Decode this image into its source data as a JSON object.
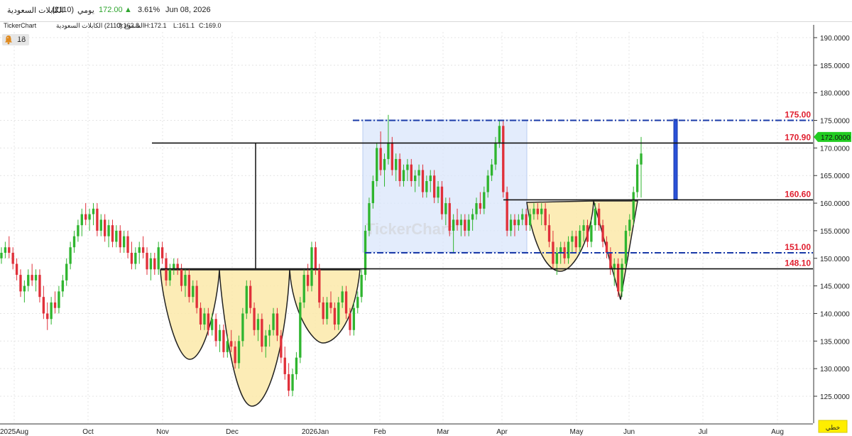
{
  "header": {
    "symbol_name": "الكابلات السعودية",
    "symbol_code": "(2110)",
    "interval": "يومي",
    "last_price": "172.00",
    "change_arrow": "▲",
    "change_pct": "3.61%",
    "date": "Jun 08, 2026"
  },
  "subheader": {
    "brand": "TickerChart",
    "series_label": "الشموع (2110) الكابلات السعودية",
    "open": "O:162.8",
    "high": "H:172.1",
    "low": "L:161.1",
    "close": "C:169.0"
  },
  "alerts": {
    "count": "18"
  },
  "watermark": "TickerChart",
  "colors": {
    "up": "#2fb52f",
    "down": "#e0303a",
    "shade_pattern": "#fbe9a9",
    "shade_box": "#d9e6fb",
    "level_label": "#e02030",
    "blue_line": "#1a3aa8"
  },
  "chart_data": {
    "type": "candlestick",
    "x_tick_labels": [
      "2025Aug",
      "Oct",
      "Nov",
      "Dec",
      "2026Jan",
      "Feb",
      "Mar",
      "Apr",
      "May",
      "Jun",
      "Jul",
      "Aug"
    ],
    "y_tick_labels": [
      "125.0000",
      "130.0000",
      "135.0000",
      "140.0000",
      "145.0000",
      "150.0000",
      "155.0000",
      "160.0000",
      "165.0000",
      "170.0000",
      "175.0000",
      "180.0000",
      "185.0000",
      "190.0000"
    ],
    "ylim": [
      122,
      192
    ],
    "current_price_label": "172.0000",
    "corner_label": "خطي",
    "levels": [
      {
        "label": "175.00",
        "value": 175.0,
        "style": "dash-dot",
        "color": "blue"
      },
      {
        "label": "170.90",
        "value": 170.9,
        "style": "solid",
        "color": "black"
      },
      {
        "label": "160.60",
        "value": 160.6,
        "style": "solid",
        "color": "black"
      },
      {
        "label": "151.00",
        "value": 151.0,
        "style": "dash-dot",
        "color": "blue"
      },
      {
        "label": "148.10",
        "value": 148.1,
        "style": "solid",
        "color": "black"
      }
    ],
    "series": [
      {
        "values": [
          [
            150,
            152,
            149,
            151
          ],
          [
            151,
            153,
            150,
            152
          ],
          [
            152,
            154,
            150,
            151
          ],
          [
            151,
            152,
            148,
            149
          ],
          [
            149,
            150,
            146,
            147
          ],
          [
            147,
            148,
            143,
            144
          ],
          [
            144,
            146,
            142,
            145
          ],
          [
            145,
            148,
            144,
            147
          ],
          [
            147,
            149,
            145,
            146
          ],
          [
            146,
            148,
            144,
            147
          ],
          [
            147,
            148,
            142,
            143
          ],
          [
            143,
            145,
            139,
            140
          ],
          [
            140,
            142,
            137,
            139
          ],
          [
            139,
            143,
            138,
            142
          ],
          [
            142,
            144,
            140,
            141
          ],
          [
            141,
            145,
            140,
            144
          ],
          [
            144,
            147,
            143,
            146
          ],
          [
            146,
            150,
            145,
            149
          ],
          [
            149,
            153,
            148,
            152
          ],
          [
            152,
            155,
            151,
            154
          ],
          [
            154,
            157,
            153,
            156
          ],
          [
            156,
            159,
            154,
            158
          ],
          [
            158,
            160,
            156,
            157
          ],
          [
            157,
            159,
            155,
            158
          ],
          [
            158,
            160,
            156,
            159
          ],
          [
            159,
            160,
            154,
            155
          ],
          [
            155,
            158,
            154,
            157
          ],
          [
            157,
            158,
            153,
            154
          ],
          [
            154,
            157,
            152,
            156
          ],
          [
            156,
            157,
            152,
            153
          ],
          [
            153,
            156,
            152,
            155
          ],
          [
            155,
            156,
            151,
            152
          ],
          [
            152,
            155,
            151,
            154
          ],
          [
            154,
            155,
            150,
            151
          ],
          [
            151,
            153,
            148,
            149
          ],
          [
            149,
            152,
            148,
            151
          ],
          [
            151,
            153,
            149,
            152
          ],
          [
            152,
            154,
            150,
            151
          ],
          [
            151,
            152,
            147,
            148
          ],
          [
            148,
            151,
            146,
            150
          ],
          [
            150,
            151,
            147,
            148
          ],
          [
            148,
            153,
            147,
            152
          ],
          [
            152,
            153,
            149,
            150
          ],
          [
            150,
            151,
            145,
            146
          ],
          [
            146,
            149,
            145,
            148
          ],
          [
            148,
            150,
            147,
            149
          ],
          [
            149,
            150,
            147,
            148
          ],
          [
            148,
            149,
            144,
            145
          ],
          [
            145,
            148,
            143,
            147
          ],
          [
            147,
            148,
            142,
            143
          ],
          [
            143,
            146,
            142,
            145
          ],
          [
            145,
            146,
            140,
            141
          ],
          [
            141,
            142,
            137,
            138
          ],
          [
            138,
            141,
            137,
            140
          ],
          [
            140,
            141,
            136,
            137
          ],
          [
            137,
            140,
            136,
            139
          ],
          [
            139,
            140,
            134,
            135
          ],
          [
            135,
            138,
            133,
            137
          ],
          [
            137,
            138,
            132,
            133
          ],
          [
            133,
            136,
            132,
            135
          ],
          [
            135,
            137,
            133,
            134
          ],
          [
            134,
            135,
            130,
            131
          ],
          [
            131,
            136,
            130,
            135
          ],
          [
            135,
            141,
            134,
            140
          ],
          [
            140,
            146,
            139,
            145
          ],
          [
            145,
            146,
            140,
            141
          ],
          [
            141,
            142,
            136,
            137
          ],
          [
            137,
            140,
            135,
            139
          ],
          [
            139,
            140,
            133,
            134
          ],
          [
            134,
            137,
            132,
            136
          ],
          [
            136,
            138,
            134,
            137
          ],
          [
            137,
            141,
            136,
            140
          ],
          [
            140,
            141,
            135,
            136
          ],
          [
            136,
            137,
            131,
            132
          ],
          [
            132,
            134,
            128,
            129
          ],
          [
            129,
            131,
            125,
            126
          ],
          [
            126,
            130,
            125,
            129
          ],
          [
            129,
            133,
            128,
            132
          ],
          [
            132,
            143,
            131,
            142
          ],
          [
            142,
            148,
            141,
            147
          ],
          [
            147,
            149,
            144,
            145
          ],
          [
            145,
            153,
            144,
            152
          ],
          [
            152,
            153,
            147,
            148
          ],
          [
            148,
            149,
            141,
            142
          ],
          [
            142,
            143,
            138,
            139
          ],
          [
            139,
            143,
            138,
            142
          ],
          [
            142,
            144,
            140,
            141
          ],
          [
            141,
            142,
            137,
            138
          ],
          [
            138,
            143,
            137,
            142
          ],
          [
            142,
            145,
            141,
            144
          ],
          [
            144,
            145,
            139,
            140
          ],
          [
            140,
            141,
            136,
            137
          ],
          [
            137,
            142,
            136,
            141
          ],
          [
            141,
            144,
            140,
            143
          ],
          [
            143,
            148,
            142,
            147
          ],
          [
            147,
            156,
            146,
            155
          ],
          [
            155,
            161,
            154,
            160
          ],
          [
            160,
            165,
            159,
            164
          ],
          [
            164,
            171,
            163,
            170
          ],
          [
            170,
            173,
            165,
            166
          ],
          [
            166,
            169,
            163,
            168
          ],
          [
            168,
            176,
            167,
            171
          ],
          [
            171,
            172,
            165,
            166
          ],
          [
            166,
            169,
            164,
            168
          ],
          [
            168,
            169,
            163,
            164
          ],
          [
            164,
            167,
            163,
            166
          ],
          [
            166,
            168,
            164,
            167
          ],
          [
            167,
            168,
            163,
            164
          ],
          [
            164,
            166,
            162,
            165
          ],
          [
            165,
            167,
            163,
            166
          ],
          [
            166,
            167,
            161,
            162
          ],
          [
            162,
            165,
            161,
            164
          ],
          [
            164,
            166,
            162,
            165
          ],
          [
            165,
            166,
            160,
            161
          ],
          [
            161,
            164,
            160,
            163
          ],
          [
            163,
            164,
            157,
            158
          ],
          [
            158,
            161,
            156,
            160
          ],
          [
            160,
            161,
            154,
            155
          ],
          [
            155,
            158,
            151,
            157
          ],
          [
            157,
            159,
            155,
            156
          ],
          [
            156,
            158,
            154,
            157
          ],
          [
            157,
            158,
            154,
            155
          ],
          [
            155,
            158,
            154,
            157
          ],
          [
            157,
            159,
            155,
            158
          ],
          [
            158,
            161,
            157,
            160
          ],
          [
            160,
            162,
            158,
            159
          ],
          [
            159,
            163,
            158,
            162
          ],
          [
            162,
            166,
            161,
            165
          ],
          [
            165,
            168,
            164,
            167
          ],
          [
            167,
            172,
            166,
            171
          ],
          [
            171,
            175,
            170,
            174
          ],
          [
            174,
            175,
            161,
            162
          ],
          [
            162,
            163,
            154,
            155
          ],
          [
            155,
            158,
            154,
            157
          ],
          [
            157,
            158,
            154,
            156
          ],
          [
            156,
            158,
            155,
            157
          ],
          [
            157,
            159,
            156,
            158
          ],
          [
            158,
            159,
            155,
            156
          ],
          [
            156,
            159,
            155,
            158
          ],
          [
            158,
            160,
            157,
            159
          ],
          [
            159,
            160,
            157,
            158
          ],
          [
            158,
            160,
            156,
            159
          ],
          [
            159,
            160,
            155,
            156
          ],
          [
            156,
            158,
            152,
            153
          ],
          [
            153,
            155,
            148,
            149
          ],
          [
            149,
            152,
            147,
            151
          ],
          [
            151,
            153,
            149,
            152
          ],
          [
            152,
            153,
            149,
            150
          ],
          [
            150,
            154,
            149,
            153
          ],
          [
            153,
            155,
            151,
            154
          ],
          [
            154,
            155,
            151,
            152
          ],
          [
            152,
            156,
            151,
            155
          ],
          [
            155,
            157,
            153,
            156
          ],
          [
            156,
            157,
            152,
            153
          ],
          [
            153,
            157,
            152,
            156
          ],
          [
            156,
            160,
            155,
            159
          ],
          [
            159,
            160,
            155,
            156
          ],
          [
            156,
            157,
            152,
            153
          ],
          [
            153,
            154,
            150,
            151
          ],
          [
            151,
            152,
            147,
            148
          ],
          [
            148,
            150,
            145,
            149
          ],
          [
            149,
            150,
            143,
            144
          ],
          [
            144,
            150,
            143,
            149
          ],
          [
            149,
            156,
            148,
            155
          ],
          [
            155,
            158,
            154,
            157
          ],
          [
            157,
            163,
            156,
            162
          ],
          [
            162,
            168,
            161,
            167
          ],
          [
            167,
            172,
            161,
            169
          ]
        ]
      }
    ]
  }
}
